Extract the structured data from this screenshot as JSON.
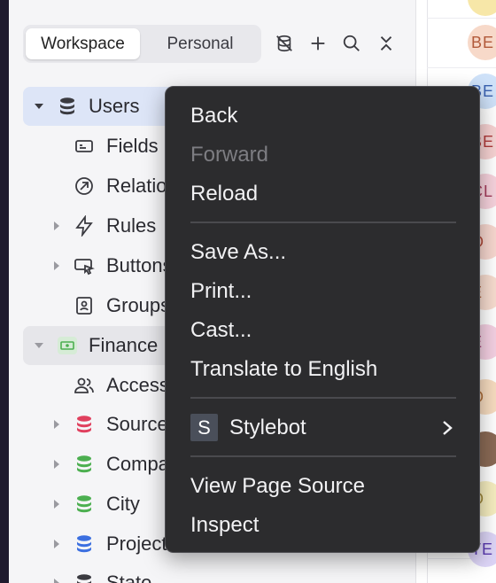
{
  "workspace_tabs": [
    {
      "label": "Workspace",
      "active": true
    },
    {
      "label": "Personal",
      "active": false
    }
  ],
  "toolbar_icons": [
    "hide-db-icon",
    "plus-icon",
    "search-icon",
    "collapse-icon"
  ],
  "tree": [
    {
      "label": "Users",
      "icon": "database-icon",
      "icon_color": "#3a3a40",
      "expandable": true,
      "expanded": true,
      "level": 0,
      "selected": true
    },
    {
      "label": "Fields",
      "icon": "fields-icon",
      "level": 1
    },
    {
      "label": "Relations",
      "icon": "relation-icon",
      "level": 1
    },
    {
      "label": "Rules",
      "icon": "lightning-icon",
      "level": 1,
      "expandable": true
    },
    {
      "label": "Buttons",
      "icon": "cursor-button-icon",
      "level": 1,
      "expandable": true
    },
    {
      "label": "Groups",
      "icon": "person-square-icon",
      "level": 1
    },
    {
      "label": "Finance",
      "icon": "money-icon",
      "icon_color": "#4caf50",
      "expandable": true,
      "expanded": true,
      "level": 0
    },
    {
      "label": "Access",
      "icon": "users-icon",
      "level": 1
    },
    {
      "label": "Sources",
      "icon": "database-icon",
      "icon_color": "#e0405e",
      "level": 1,
      "expandable": true
    },
    {
      "label": "Companies",
      "icon": "database-icon",
      "icon_color": "#4caf50",
      "level": 1,
      "expandable": true
    },
    {
      "label": "City",
      "icon": "database-icon",
      "icon_color": "#4caf50",
      "level": 1,
      "expandable": true
    },
    {
      "label": "Projects",
      "icon": "database-icon",
      "icon_color": "#3b6fe0",
      "level": 1,
      "expandable": true
    },
    {
      "label": "State",
      "icon": "database-icon",
      "icon_color": "#3a3a40",
      "level": 1,
      "expandable": true
    }
  ],
  "avatars": [
    {
      "text": "",
      "bg": "#f7e7a8"
    },
    {
      "text": "BE",
      "bg": "#f7d9c9",
      "color": "#b25a3a"
    },
    {
      "text": "BE",
      "bg": "#cfe2f9",
      "color": "#3a62b0"
    },
    {
      "text": "BE",
      "bg": "#f6d2d2",
      "color": "#b03a3a"
    },
    {
      "text": "CL",
      "bg": "#f6d2dc",
      "color": "#a33a5a"
    },
    {
      "text": "O",
      "bg": "#f7d7cf",
      "color": "#b04a3a"
    },
    {
      "text": "E",
      "bg": "#f7dccf",
      "color": "#b0603a"
    },
    {
      "text": "E",
      "bg": "#f4d0e2",
      "color": "#a33a73"
    },
    {
      "text": "O",
      "bg": "#f7dcc0",
      "color": "#b0703a"
    },
    {
      "text": "",
      "bg": "#8a6a55"
    },
    {
      "text": "O",
      "bg": "#f6eec0",
      "color": "#a0883a"
    },
    {
      "text": "TE",
      "bg": "#ddd5f7",
      "color": "#5a3ab0"
    }
  ],
  "context_menu": {
    "items": [
      {
        "label": "Back",
        "enabled": true
      },
      {
        "label": "Forward",
        "enabled": false
      },
      {
        "label": "Reload",
        "enabled": true
      },
      {
        "label": "Save As...",
        "enabled": true
      },
      {
        "label": "Print...",
        "enabled": true
      },
      {
        "label": "Cast...",
        "enabled": true
      },
      {
        "label": "Translate to English",
        "enabled": true
      },
      {
        "label": "Stylebot",
        "enabled": true,
        "badge": "S",
        "submenu": true
      },
      {
        "label": "View Page Source",
        "enabled": true
      },
      {
        "label": "Inspect",
        "enabled": true
      }
    ]
  }
}
